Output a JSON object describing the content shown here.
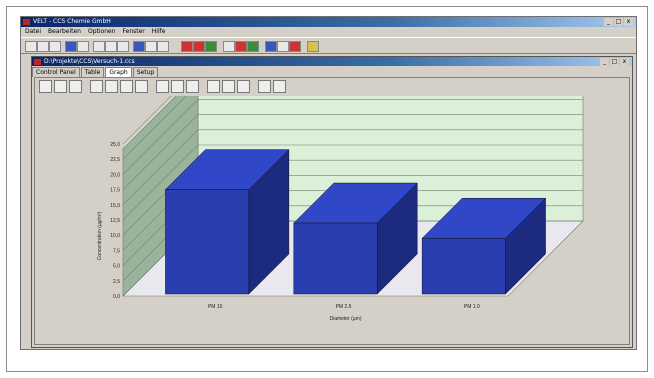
{
  "app": {
    "title": "VELT - CCS Chemie GmbH",
    "window_buttons": [
      "_",
      "□",
      "x"
    ]
  },
  "menu": [
    "Datei",
    "Bearbeiten",
    "Optionen",
    "Fenster",
    "Hilfe"
  ],
  "document": {
    "title": "D:\\Projekte\\CCS\\Versuch-1.ccs"
  },
  "tabs": [
    "Control Panel",
    "Table",
    "Graph",
    "Setup"
  ],
  "active_tab": "Graph",
  "chart_data": {
    "type": "bar",
    "style": "3d",
    "categories": [
      "PM 10",
      "PM 2.5",
      "PM 1.0"
    ],
    "values": [
      17.5,
      12.0,
      9.5
    ],
    "ylim": [
      0,
      25
    ],
    "yticks": [
      "0,0",
      "2,5",
      "5,0",
      "7,5",
      "10,0",
      "12,5",
      "15,0",
      "17,5",
      "20,0",
      "22,5",
      "25,0"
    ],
    "xlabel": "Diameter (µm)",
    "ylabel": "Concentration (µg/m³)",
    "bar_color": "#2a3eb0",
    "bar_top_color": "#3048c8",
    "bar_side_color": "#1c2a80",
    "wall_color": "#dcefd8",
    "side_wall_color": "#9ab39a",
    "floor_color": "#e8e8ee",
    "grid": true
  }
}
